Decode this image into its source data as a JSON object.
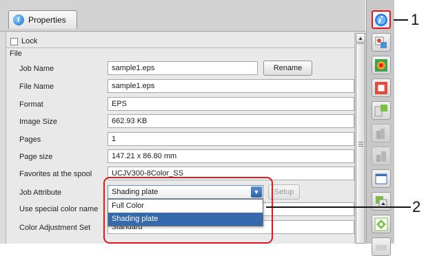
{
  "tab": {
    "label": "Properties"
  },
  "lock": {
    "label": "Lock"
  },
  "section": {
    "file": "File"
  },
  "properties": [
    {
      "label": "Job Name",
      "value": "sample1.eps"
    },
    {
      "label": "File Name",
      "value": "sample1.eps"
    },
    {
      "label": "Format",
      "value": "EPS"
    },
    {
      "label": "Image Size",
      "value": "662.93 KB"
    },
    {
      "label": "Pages",
      "value": "1"
    },
    {
      "label": "Page size",
      "value": "147.21 x 86.80 mm"
    },
    {
      "label": "Favorites at the spool",
      "value": "UCJV300-8Color_SS"
    },
    {
      "label": "Job Attribute",
      "value": "Shading plate"
    },
    {
      "label": "Use special color name",
      "value": ""
    },
    {
      "label": "Color Adjustment Set",
      "value": "Standard"
    }
  ],
  "buttons": {
    "rename": "Rename",
    "setup": "Setup"
  },
  "dropdown": {
    "options": [
      "Full Color",
      "Shading plate"
    ],
    "selected": "Shading plate"
  },
  "callouts": [
    "1",
    "2"
  ],
  "colors": {
    "highlight": "#e3151c",
    "selection": "#3569ad"
  },
  "toolbar_icons": [
    "info-icon",
    "move-to-icon",
    "color-icon",
    "crop-icon",
    "layout-icon",
    "duplicate-icon",
    "duplicate-alt-icon",
    "print-preview-icon",
    "job-queue-icon",
    "tile-icon",
    "more-icon"
  ]
}
